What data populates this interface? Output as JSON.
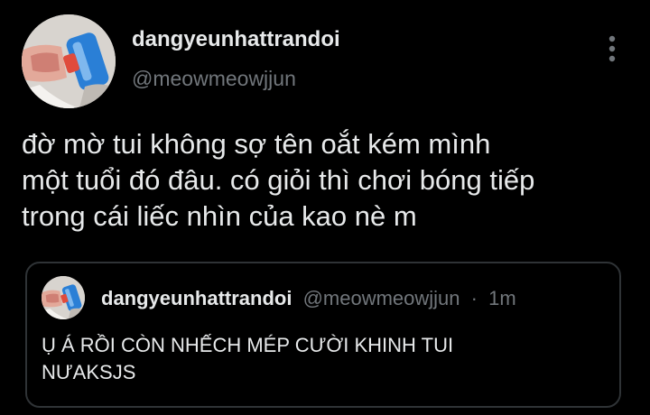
{
  "tweet": {
    "author": {
      "display_name": "dangyeunhattrandoi",
      "handle": "@meowmeowjjun",
      "avatar_icon": "avatar-photo"
    },
    "more_icon": "more-vertical-icon",
    "text": "đờ mờ tui không sợ tên oắt kém mình\nmột tuổi đó đâu. có giỏi thì chơi bóng tiếp\ntrong cái liếc nhìn của kao nè m",
    "quoted": {
      "display_name": "dangyeunhattrandoi",
      "handle": "@meowmeowjjun",
      "separator": "·",
      "time": "1m",
      "text": "Ụ Á RỒI CÒN NHẾCH MÉP CƯỜI KHINH TUI\nNƯAKSJS"
    }
  },
  "colors": {
    "background": "#000000",
    "primary_text": "#e7e9ea",
    "secondary_text": "#71767b",
    "border": "#2f3336"
  }
}
